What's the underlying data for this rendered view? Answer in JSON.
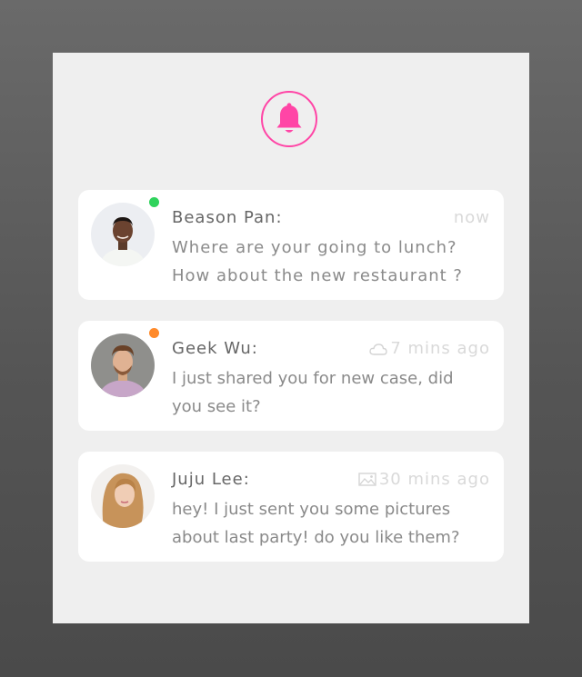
{
  "colors": {
    "accent": "#ff45a6",
    "online": "#2fd35c",
    "away": "#ff8a2a",
    "card_bg": "#ffffff",
    "panel_bg": "#efefef"
  },
  "header": {
    "icon": "bell-icon"
  },
  "messages": [
    {
      "name": "Beason Pan:",
      "time": "now",
      "time_icon": null,
      "status": "online",
      "lines": [
        "Where are your going to lunch?",
        "How about the new restaurant ?"
      ]
    },
    {
      "name": "Geek Wu:",
      "time": "7 mins ago",
      "time_icon": "cloud-icon",
      "status": "away",
      "lines": [
        "I just shared you for new case, did",
        "you see it?"
      ]
    },
    {
      "name": "Juju Lee:",
      "time": "30 mins ago",
      "time_icon": "image-icon",
      "status": null,
      "lines": [
        "hey! I just sent you some pictures",
        "about last party! do you like them?"
      ]
    }
  ]
}
